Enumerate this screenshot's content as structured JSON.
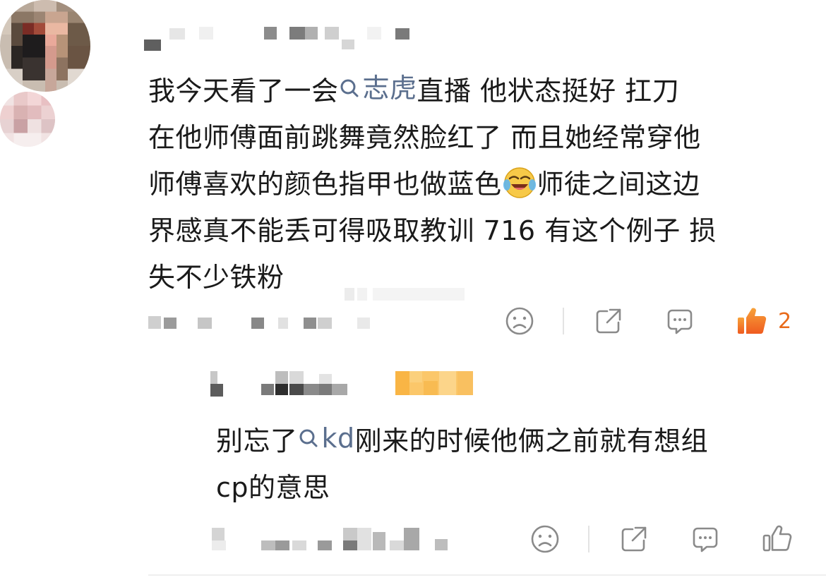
{
  "comment": {
    "lines": [
      {
        "before": "我今天看了一会",
        "topic": "志虎",
        "after": "直播 他状态挺好  扛刀"
      },
      {
        "text": "在他师傅面前跳舞竟然脸红了 而且她经常穿他"
      },
      {
        "before": "师傅喜欢的颜色指甲也做蓝色",
        "emoji": "laughing-crying-emoji",
        "after": "师徒之间这边"
      },
      {
        "text": "界感真不能丢可得吸取教训 716 有这个例子 损"
      },
      {
        "text": "失不少铁粉"
      }
    ],
    "like_count": "2",
    "icons": [
      "sad-face-icon",
      "share-icon",
      "comment-icon",
      "like-filled-icon"
    ]
  },
  "reply": {
    "lines": [
      {
        "before": "别忘了",
        "topic": "kd",
        "after": "刚来的时候他俩之前就有想组"
      },
      {
        "text": "cp的意思"
      }
    ],
    "icons": [
      "sad-face-icon",
      "share-icon",
      "comment-icon",
      "like-outline-icon"
    ]
  },
  "colors": {
    "topic_link": "#5b6f8e",
    "like_active": "#e86a1a",
    "icon_gray": "#8a8a8a"
  }
}
